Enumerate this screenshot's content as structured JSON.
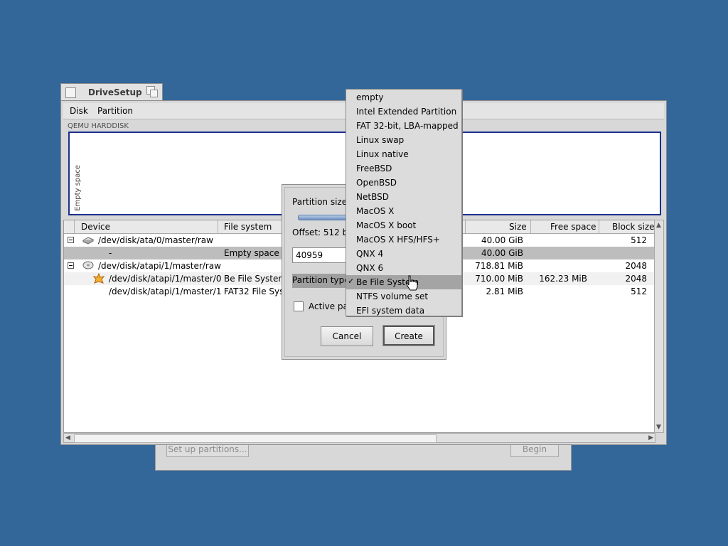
{
  "background_window": {
    "setup_button": "Set up partitions...",
    "begin_button": "Begin"
  },
  "window": {
    "title": "DriveSetup",
    "menus": [
      "Disk",
      "Partition"
    ],
    "disk_name": "QEMU HARDDISK",
    "map_label": "Empty space"
  },
  "table": {
    "columns": [
      "Device",
      "File system",
      "Size",
      "Free space",
      "Block size"
    ],
    "rows": [
      {
        "device": "/dev/disk/ata/0/master/raw",
        "fs": "",
        "size": "40.00 GiB",
        "free": "",
        "block": "512",
        "icon": "harddisk-icon",
        "expander": true,
        "style": ""
      },
      {
        "device": "-",
        "fs": "Empty space",
        "size": "40.00 GiB",
        "free": "",
        "block": "",
        "icon": "",
        "expander": false,
        "style": "sel"
      },
      {
        "device": "/dev/disk/atapi/1/master/raw",
        "fs": "",
        "size": "718.81 MiB",
        "free": "",
        "block": "2048",
        "icon": "cdrom-icon",
        "expander": true,
        "style": ""
      },
      {
        "device": "/dev/disk/atapi/1/master/0",
        "fs": "Be File System",
        "size": "710.00 MiB",
        "free": "162.23 MiB",
        "block": "2048",
        "icon": "haiku-leaf-icon",
        "expander": false,
        "style": "alt"
      },
      {
        "device": "/dev/disk/atapi/1/master/1",
        "fs": "FAT32 File Syste",
        "size": "2.81 MiB",
        "free": "",
        "block": "512",
        "icon": "",
        "expander": false,
        "style": ""
      }
    ]
  },
  "dialog": {
    "size_label": "Partition size",
    "offset_label": "Offset: 512 byt",
    "size_value": "40959",
    "type_label": "Partition type:",
    "active_label": "Active par",
    "cancel": "Cancel",
    "create": "Create"
  },
  "popup": {
    "items": [
      "empty",
      "Intel Extended Partition",
      "FAT 32-bit, LBA-mapped",
      "Linux swap",
      "Linux native",
      "FreeBSD",
      "OpenBSD",
      "NetBSD",
      "MacOS X",
      "MacOS X boot",
      "MacOS X HFS/HFS+",
      "QNX 4",
      "QNX 6",
      "Be File System",
      "NTFS volume set",
      "EFI system data"
    ],
    "selected": "Be File System",
    "check_mark": "✓"
  }
}
